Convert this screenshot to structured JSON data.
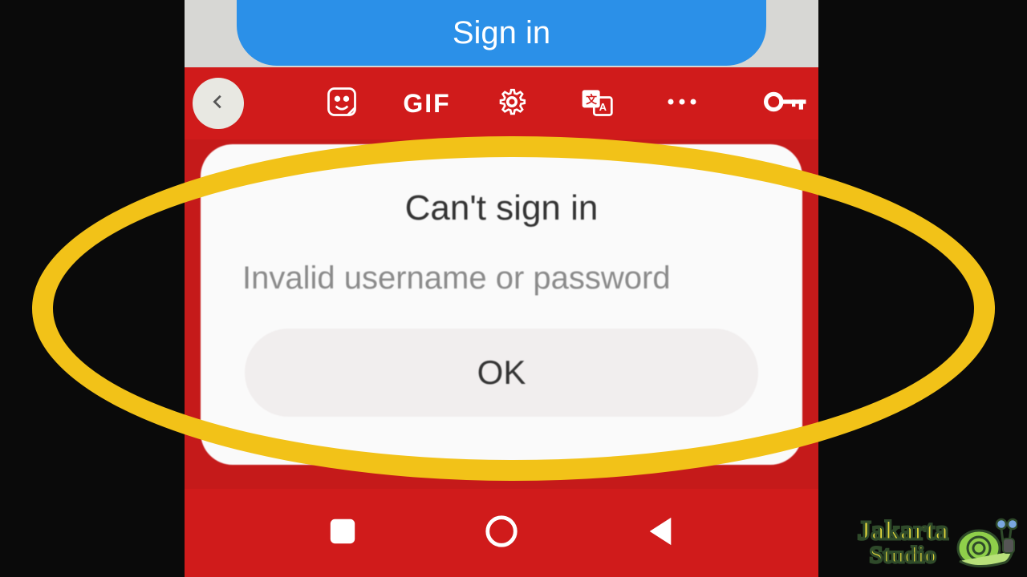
{
  "top": {
    "signin_label": "Sign in"
  },
  "toolbar": {
    "gif_label": "GIF",
    "icons": {
      "back": "chevron-left",
      "sticker": "sticker",
      "gif": "gif",
      "settings": "gear",
      "translate": "translate",
      "more": "more",
      "key": "key"
    }
  },
  "dialog": {
    "title": "Can't sign in",
    "message": "Invalid username or password",
    "ok_label": "OK"
  },
  "navbar": {
    "recent": "recent",
    "home": "home",
    "back": "back"
  },
  "watermark": {
    "line1": "Jakarta",
    "line2": "Studio"
  },
  "highlight_color": "#f2c218"
}
